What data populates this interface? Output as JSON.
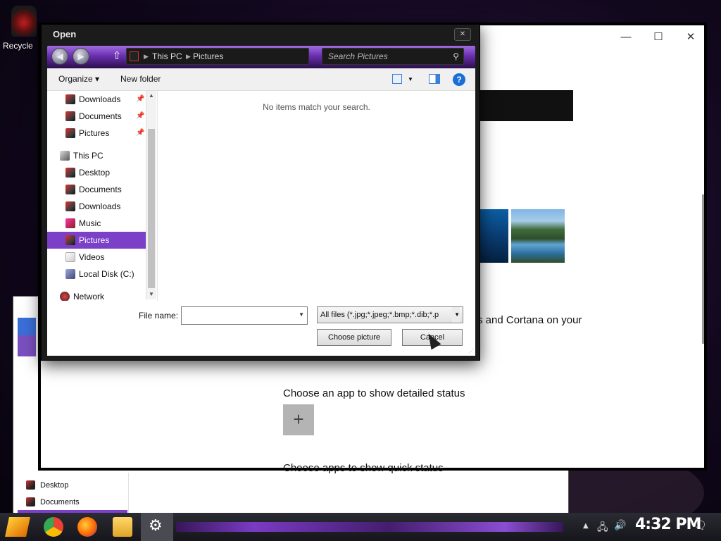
{
  "desktop": {
    "recycle_label": "Recycle"
  },
  "background_explorer": {
    "nav_items": [
      "Desktop",
      "Documents"
    ]
  },
  "settings_window": {
    "controls": {
      "minimize": "—",
      "maximize": "☐",
      "close": "✕"
    },
    "text_partial": "s and Cortana on your",
    "detailed_status": "Choose an app to show detailed status",
    "add_symbol": "+",
    "quick_status": "Choose apps to show quick status"
  },
  "dialog": {
    "title": "Open",
    "close": "✕",
    "breadcrumb": [
      "This PC",
      "Pictures"
    ],
    "search_placeholder": "Search Pictures",
    "toolbar": {
      "organize": "Organize ▾",
      "new_folder": "New folder",
      "help": "?"
    },
    "nav_items": [
      {
        "label": "Downloads",
        "pinned": true
      },
      {
        "label": "Documents",
        "pinned": true
      },
      {
        "label": "Pictures",
        "pinned": true
      },
      {
        "label": "This PC"
      },
      {
        "label": "Desktop"
      },
      {
        "label": "Documents"
      },
      {
        "label": "Downloads"
      },
      {
        "label": "Music"
      },
      {
        "label": "Pictures",
        "selected": true
      },
      {
        "label": "Videos"
      },
      {
        "label": "Local Disk (C:)"
      },
      {
        "label": "Network"
      }
    ],
    "pin_glyph": "📌",
    "empty_message": "No items match your search.",
    "file_name_label": "File name:",
    "file_name_value": "",
    "file_type": "All files (*.jpg;*.jpeg;*.bmp;*.dib;*.p",
    "choose_button": "Choose picture",
    "cancel_button": "Cancel"
  },
  "taskbar": {
    "clock": "4:32 PM",
    "settings_glyph": "⚙"
  },
  "colors": {
    "accent_purple": "#7b3fc8",
    "help_blue": "#1a6fd6"
  }
}
